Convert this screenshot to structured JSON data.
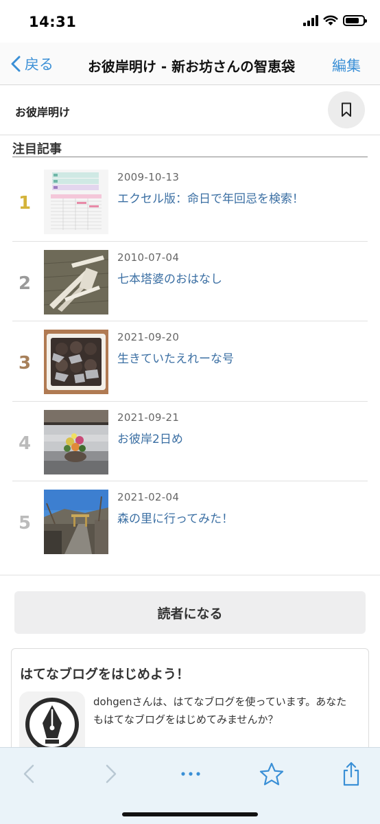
{
  "status": {
    "time": "14:31"
  },
  "nav": {
    "back_label": "戻る",
    "title": "お彼岸明け - 新お坊さんの智恵袋",
    "edit_label": "編集"
  },
  "blog": {
    "name": "お彼岸明け"
  },
  "section": {
    "title": "注目記事"
  },
  "articles": [
    {
      "rank": "1",
      "date": "2009-10-13",
      "title": "エクセル版：命日で年回忌を検索！",
      "rank_color": "#d4b33a"
    },
    {
      "rank": "2",
      "date": "2010-07-04",
      "title": "七本塔婆のおはなし",
      "rank_color": "#9a9a9a"
    },
    {
      "rank": "3",
      "date": "2021-09-20",
      "title": "生きていたえれーな号",
      "rank_color": "#a7805a"
    },
    {
      "rank": "4",
      "date": "2021-09-21",
      "title": "お彼岸2日め",
      "rank_color": "#bbbbbb"
    },
    {
      "rank": "5",
      "date": "2021-02-04",
      "title": "森の里に行ってみた！",
      "rank_color": "#bbbbbb"
    }
  ],
  "subscribe": {
    "label": "読者になる"
  },
  "promo": {
    "title": "はてなブログをはじめよう！",
    "text": "dohgenさんは、はてなブログを使っています。あなたもはてなブログをはじめてみませんか？"
  },
  "toolbar": {
    "items": [
      "back-arrow-icon",
      "forward-arrow-icon",
      "more-dots-icon",
      "star-icon",
      "share-icon"
    ]
  },
  "colors": {
    "accent": "#3a8fd6",
    "link": "#3b6fa3",
    "toolbar_bg": "#eaf3f9"
  }
}
